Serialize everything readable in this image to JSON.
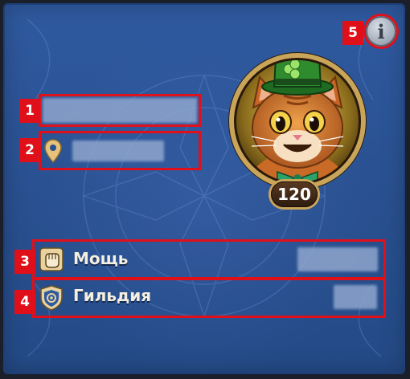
{
  "profile": {
    "name": "",
    "location": "",
    "level": "120",
    "info_icon": "info-icon"
  },
  "stats": [
    {
      "num": "3",
      "label": "Мощь",
      "icon": "power-fist-icon",
      "value": ""
    },
    {
      "num": "4",
      "label": "Гильдия",
      "icon": "guild-shield-icon",
      "value": ""
    }
  ],
  "markers": [
    "1",
    "2",
    "3",
    "4",
    "5"
  ],
  "colors": {
    "panel": "#2f5aa0",
    "highlight": "#e0101a",
    "label_text": "#f4efe0",
    "avatar_ring": "#c9a55a",
    "hat_green": "#2e8b2e",
    "cat_orange": "#d9782a"
  }
}
